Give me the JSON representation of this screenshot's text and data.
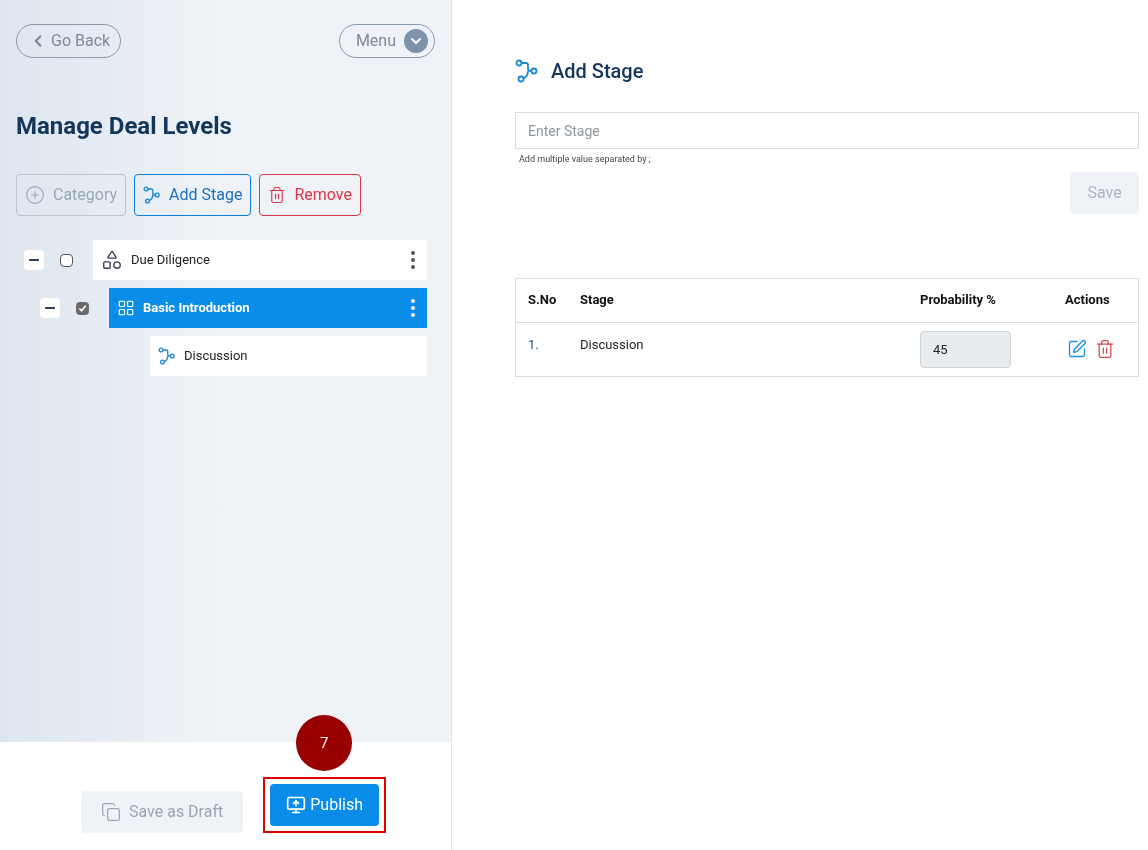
{
  "sidebar": {
    "back_button": "Go Back",
    "menu_button": "Menu",
    "title": "Manage Deal Levels",
    "toolbar": [
      {
        "kind": "category",
        "label": "Category",
        "disabled": true
      },
      {
        "kind": "stage",
        "label": "Add Stage",
        "disabled": false
      },
      {
        "kind": "remove",
        "label": "Remove",
        "disabled": false
      }
    ],
    "tree": [
      {
        "label": "Due Diligence",
        "kind": "category",
        "expanded": true,
        "checked": false,
        "selected": false,
        "children": [
          {
            "label": "Basic Introduction",
            "kind": "group",
            "expanded": true,
            "checked": true,
            "selected": true,
            "children": [
              {
                "label": "Discussion",
                "kind": "stage",
                "selected": false
              }
            ]
          }
        ]
      }
    ],
    "footer": {
      "draft_button": {
        "label": "Save as Draft",
        "disabled": true
      },
      "publish_button": {
        "label": "Publish",
        "disabled": false,
        "highlighted": true
      },
      "step_marker": "7"
    }
  },
  "main": {
    "title": "Add Stage",
    "stage_field": {
      "placeholder": "Enter Stage"
    },
    "hint": "Add multiple value separated by ;",
    "save_button": {
      "label": "Save",
      "disabled": true
    },
    "table": {
      "columns": [
        "S.No",
        "Stage",
        "Probability %",
        "Actions"
      ],
      "rows": [
        {
          "s_no": "1.",
          "stage": "Discussion",
          "probability": "45"
        }
      ]
    }
  }
}
